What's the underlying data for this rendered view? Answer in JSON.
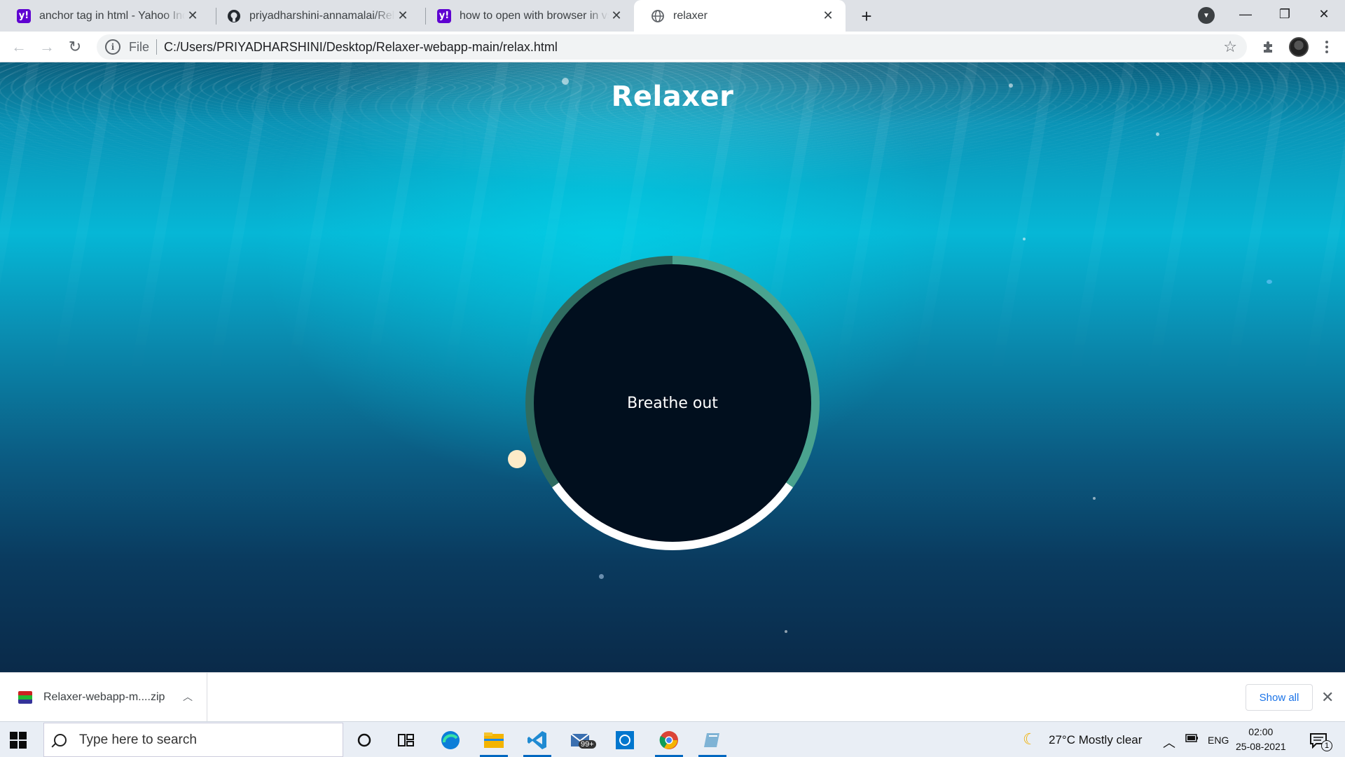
{
  "browser": {
    "tabs": [
      {
        "title": "anchor tag in html - Yahoo India",
        "favicon": "yahoo-icon",
        "active": false
      },
      {
        "title": "priyadharshini-annamalai/Relaxer",
        "favicon": "github-icon",
        "active": false
      },
      {
        "title": "how to open with browser in vs code",
        "favicon": "yahoo-icon",
        "active": false
      },
      {
        "title": "relaxer",
        "favicon": "globe-icon",
        "active": true
      }
    ],
    "address": {
      "scheme_label": "File",
      "url": "C:/Users/PRIYADHARSHINI/Desktop/Relaxer-webapp-main/relax.html"
    }
  },
  "page": {
    "title": "Relaxer",
    "breath_text": "Breathe out",
    "colors": {
      "ring_primary": "#4aa38f",
      "ring_dark": "#2f6c60",
      "ring_highlight": "#ffffff",
      "circle_fill": "#010f1e",
      "pointer": "#fdebc8"
    }
  },
  "downloads": {
    "file_name": "Relaxer-webapp-m....zip",
    "show_all_label": "Show all"
  },
  "taskbar": {
    "search_placeholder": "Type here to search",
    "mail_badge": "99+",
    "weather": "27°C  Mostly clear",
    "language": "ENG",
    "time": "02:00",
    "date": "25-08-2021",
    "notification_count": "1"
  }
}
